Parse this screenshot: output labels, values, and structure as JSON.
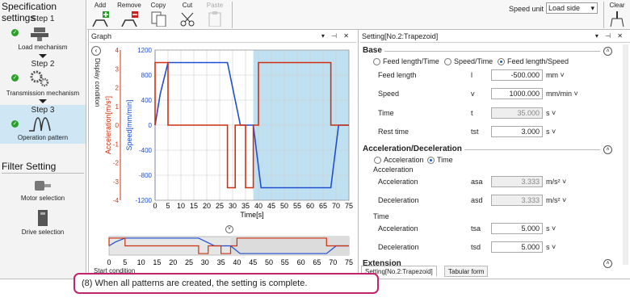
{
  "left": {
    "spec_title": "Specification settings",
    "steps": [
      {
        "label": "Step 1",
        "sub": "Load mechanism"
      },
      {
        "label": "Step 2",
        "sub": "Transmission mechanism"
      },
      {
        "label": "Step 3",
        "sub": "Operation pattern"
      }
    ],
    "filter_title": "Filter Setting",
    "filters": [
      "Motor selection",
      "Drive selection"
    ]
  },
  "toolbar": {
    "add": "Add",
    "remove": "Remove",
    "copy": "Copy",
    "cut": "Cut",
    "paste": "Paste",
    "speed_unit_label": "Speed unit",
    "speed_unit_value": "Load side",
    "clear": "Clear"
  },
  "graph": {
    "title": "Graph",
    "display_condition": "Display condition",
    "ylabel_left": "Acceleration[m/s²]",
    "ylabel_right": "Speed[mm/min]",
    "xlabel": "Time[s]",
    "start_condition": "Start condition"
  },
  "chart_data": {
    "type": "line",
    "xlim": [
      0,
      75
    ],
    "x_ticks": [
      0,
      5,
      10,
      15,
      20,
      25,
      30,
      35,
      40,
      45,
      50,
      55,
      60,
      65,
      70,
      75
    ],
    "y_left_ticks": [
      4,
      3,
      2,
      1,
      0,
      -1,
      -2,
      -3,
      -4
    ],
    "y_right_ticks": [
      1200,
      800,
      400,
      0,
      -400,
      -800,
      -1200
    ],
    "ylim_left": [
      -4,
      4
    ],
    "ylim_right": [
      -1200,
      1200
    ],
    "highlight_range": [
      38,
      75
    ],
    "series": [
      {
        "axis": "right",
        "color": "#1f4fd0",
        "x": [
          0,
          2,
          5,
          28,
          33,
          35,
          38,
          41,
          66,
          68,
          71,
          75
        ],
        "y": [
          0,
          500,
          1000,
          1000,
          0,
          0,
          0,
          -1000,
          -1000,
          -1000,
          0,
          0
        ]
      },
      {
        "axis": "left",
        "color": "#d03010",
        "x": [
          0,
          0,
          5,
          5,
          28,
          28,
          31,
          31,
          35,
          35,
          38,
          38,
          40,
          40,
          68,
          68,
          71,
          71,
          75
        ],
        "y": [
          0,
          3.333,
          3.333,
          0,
          0,
          -3.333,
          -3.333,
          0,
          0,
          -3.333,
          -3.333,
          0,
          0,
          3.333,
          3.333,
          0,
          0,
          0,
          0
        ]
      }
    ],
    "mini_x_ticks": [
      0,
      5,
      10,
      15,
      20,
      25,
      30,
      35,
      40,
      45,
      50,
      55,
      60,
      65,
      70,
      75
    ]
  },
  "setting": {
    "title": "Setting[No.2:Trapezoid]",
    "base_title": "Base",
    "radios": [
      "Feed length/Time",
      "Speed/Time",
      "Feed length/Speed"
    ],
    "rows": [
      {
        "label": "Feed length",
        "sym": "l",
        "value": "-500.000",
        "unit": "mm ˅",
        "ro": false
      },
      {
        "label": "Speed",
        "sym": "v",
        "value": "1000.000",
        "unit": "mm/min ˅",
        "ro": false
      },
      {
        "label": "Time",
        "sym": "t",
        "value": "35.000",
        "unit": "s ˅",
        "ro": true
      },
      {
        "label": "Rest time",
        "sym": "tst",
        "value": "3.000",
        "unit": "s ˅",
        "ro": false
      }
    ],
    "accel_title": "Acceleration/Deceleration",
    "accel_radios": [
      "Acceleration",
      "Time"
    ],
    "accel_sub": "Acceleration",
    "accel_rows": [
      {
        "label": "Acceleration",
        "sym": "asa",
        "value": "3.333",
        "unit": "m/s² ˅",
        "ro": true
      },
      {
        "label": "Deceleration",
        "sym": "asd",
        "value": "3.333",
        "unit": "m/s² ˅",
        "ro": true
      }
    ],
    "time_sub": "Time",
    "time_rows": [
      {
        "label": "Acceleration",
        "sym": "tsa",
        "value": "5.000",
        "unit": "s ˅",
        "ro": false
      },
      {
        "label": "Deceleration",
        "sym": "tsd",
        "value": "5.000",
        "unit": "s ˅",
        "ro": false
      }
    ],
    "extension": "Extension",
    "tab1": "Setting[No.2:Trapezoid]",
    "tab2": "Tabular form"
  },
  "callout": "(8) When all patterns are created, the setting is complete."
}
